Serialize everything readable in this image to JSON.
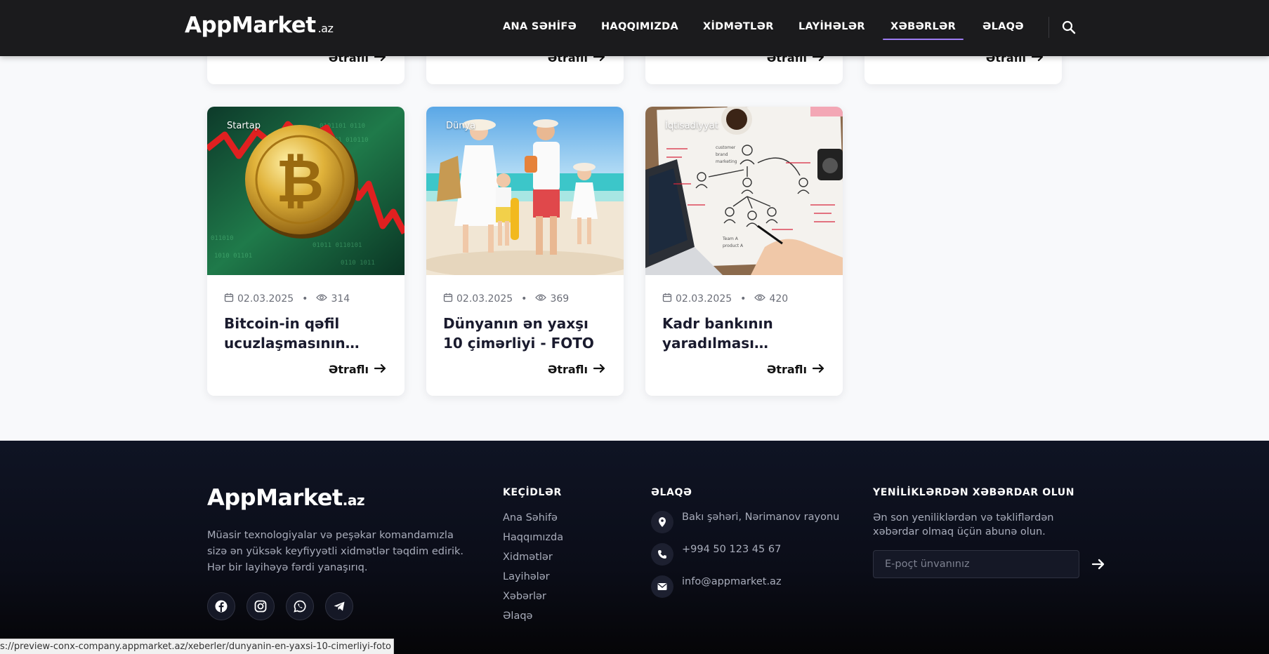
{
  "header": {
    "logo": {
      "main": "AppMarket",
      "tld": ".az"
    },
    "nav": [
      {
        "label": "ANA SƏHİFƏ",
        "active": false
      },
      {
        "label": "HAQQIMIZDA",
        "active": false
      },
      {
        "label": "XİDMƏTLƏR",
        "active": false
      },
      {
        "label": "LAYİHƏLƏR",
        "active": false
      },
      {
        "label": "XƏBƏRLƏR",
        "active": true
      },
      {
        "label": "ƏLAQƏ",
        "active": false
      }
    ],
    "search_icon": "search-icon"
  },
  "top_cards": [
    {
      "more_label": "Ətraflı"
    },
    {
      "more_label": "Ətraflı"
    },
    {
      "more_label": "Ətraflı"
    },
    {
      "more_label": "Ətraflı"
    }
  ],
  "news": [
    {
      "category": "Startap",
      "date": "02.03.2025",
      "views": "314",
      "title": "Bitcoin-in qəfil ucuzlaşmasının bütün səbəbləri",
      "more_label": "Ətraflı",
      "image": "bitcoin"
    },
    {
      "category": "Dünya",
      "date": "02.03.2025",
      "views": "369",
      "title": "Dünyanın ən yaxşı 10 çimərliyi - FOTO",
      "more_label": "Ətraflı",
      "image": "beach"
    },
    {
      "category": "İqtisadiyyat",
      "date": "02.03.2025",
      "views": "420",
      "title": "Kadr bankının yaradılması haqqında",
      "more_label": "Ətraflı",
      "image": "hr-plan"
    }
  ],
  "footer": {
    "logo": {
      "main": "AppMarket",
      "tld": ".az"
    },
    "about": "Müasir texnologiyalar və peşəkar komandamızla sizə ən yüksək keyfiyyətli xidmətlər təqdim edirik. Hər bir layihəyə fərdi yanaşırıq.",
    "socials": [
      "facebook-icon",
      "instagram-icon",
      "whatsapp-icon",
      "telegram-icon"
    ],
    "links_heading": "KEÇİDLƏR",
    "links": [
      "Ana Səhifə",
      "Haqqımızda",
      "Xidmətlər",
      "Layihələr",
      "Xəbərlər",
      "Əlaqə"
    ],
    "contact_heading": "ƏLAQƏ",
    "contacts": [
      {
        "icon": "location-pin-icon",
        "text": "Bakı şəhəri, Nərimanov rayonu"
      },
      {
        "icon": "phone-icon",
        "text": "+994 50 123 45 67"
      },
      {
        "icon": "mail-icon",
        "text": "info@appmarket.az"
      }
    ],
    "newsletter_heading": "YENİLİKLƏRDƏN XƏBƏRDAR OLUN",
    "newsletter_text": "Ən son yeniliklərdən və təkliflərdən xəbərdar olmaq üçün abunə olun.",
    "newsletter_placeholder": "E-poçt ünvanınız"
  },
  "status_bar": "s://preview-conx-company.appmarket.az/xeberler/dunyanin-en-yaxsi-10-cimerliyi-foto"
}
